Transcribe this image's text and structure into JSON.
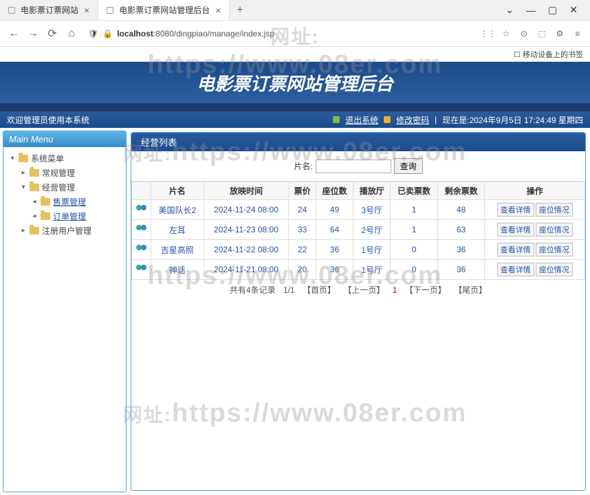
{
  "browser": {
    "tabs": [
      "电影票订票网站",
      "电影票订票网站管理后台"
    ],
    "new_tab": "+",
    "window_controls": {
      "down": "⌄",
      "min": "—",
      "max": "▢",
      "close": "✕"
    },
    "nav": {
      "back": "←",
      "forward": "→",
      "refresh": "⟳",
      "home": "⌂"
    },
    "shield": "🛡",
    "lock": "🔒",
    "url_host": "localhost",
    "url_path": ":8080/dingpiao/manage/index.jsp",
    "right_icons": [
      "⋮⋮",
      "☆",
      "⊙",
      "⬚",
      "⚙",
      "≡"
    ],
    "bookmark_bar": "☐ 移动设备上的书签"
  },
  "banner": "电影票订票网站管理后台",
  "topbar": {
    "welcome": "欢迎管理员使用本系统",
    "logout": "退出系统",
    "changepw": "修改密码",
    "datetime": "现在是:2024年9月5日 17:24:49 星期四"
  },
  "sidebar": {
    "header": "Main Menu",
    "root": "系统菜单",
    "items": [
      {
        "label": "常规管理",
        "children": []
      },
      {
        "label": "经营管理",
        "children": [
          "售票管理",
          "订单管理"
        ]
      },
      {
        "label": "注册用户管理",
        "children": []
      }
    ]
  },
  "content": {
    "title": "经营列表",
    "search_label": "片名:",
    "search_btn": "查询",
    "columns": [
      "",
      "片名",
      "放映时间",
      "票价",
      "座位数",
      "播放厅",
      "已卖票数",
      "剩余票数",
      "操作"
    ],
    "op_view": "查看详情",
    "op_seat": "座位情况",
    "rows": [
      {
        "name": "美国队长2",
        "time": "2024-11-24 08:00",
        "price": "24",
        "seats": "49",
        "hall": "3号厅",
        "sold": "1",
        "remain": "48"
      },
      {
        "name": "左耳",
        "time": "2024-11-23 08:00",
        "price": "33",
        "seats": "64",
        "hall": "2号厅",
        "sold": "1",
        "remain": "63"
      },
      {
        "name": "吉星高照",
        "time": "2024-11-22 08:00",
        "price": "22",
        "seats": "36",
        "hall": "1号厅",
        "sold": "0",
        "remain": "36"
      },
      {
        "name": "神话",
        "time": "2024-11-21 08:00",
        "price": "20",
        "seats": "36",
        "hall": "1号厅",
        "sold": "0",
        "remain": "36"
      }
    ],
    "pager": {
      "total": "共有4条记录",
      "pages": "1/1",
      "first": "【首页】",
      "prev": "【上一页】",
      "current": "1",
      "next": "【下一页】",
      "last": "【尾页】"
    }
  },
  "watermark": {
    "label": "网址:",
    "url": "https://www.08er.com"
  }
}
